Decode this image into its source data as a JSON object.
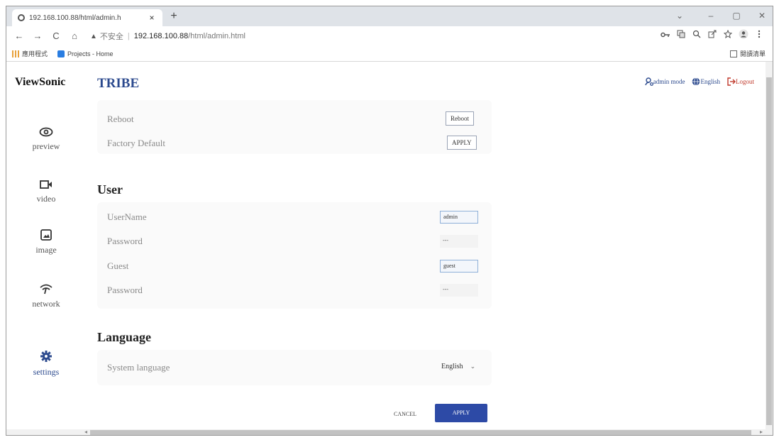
{
  "browser": {
    "tab_title": "192.168.100.88/html/admin.h",
    "tab_close": "×",
    "new_tab": "+",
    "window": {
      "collapse": "⌄",
      "minimize": "–",
      "restore": "▢",
      "close": "✕"
    },
    "nav": {
      "back": "←",
      "forward": "→",
      "reload": "C",
      "home": "⌂"
    },
    "address": {
      "warning_icon": "▲",
      "insecure_label": "不安全",
      "separator": "|",
      "host": "192.168.100.88",
      "path": "/html/admin.html"
    },
    "toolbar_icons": [
      "key-icon",
      "translate-icon",
      "zoom-icon",
      "share-icon",
      "star-icon",
      "profile-icon",
      "menu-icon"
    ],
    "bookmarks": {
      "apps": "應用程式",
      "projects": "Projects - Home",
      "reading_list": "閱讀清單"
    }
  },
  "app": {
    "brand": "ViewSonic",
    "title": "TRIBE",
    "header": {
      "admin_mode": "admin mode",
      "language": "English",
      "logout": "Logout"
    },
    "sidebar": [
      {
        "label": "preview",
        "icon": "eye-icon"
      },
      {
        "label": "video",
        "icon": "camera-icon"
      },
      {
        "label": "image",
        "icon": "image-icon"
      },
      {
        "label": "network",
        "icon": "wifi-icon"
      },
      {
        "label": "settings",
        "icon": "gear-icon",
        "active": true
      }
    ],
    "system": {
      "reboot_label": "Reboot",
      "reboot_button": "Reboot",
      "factory_label": "Factory Default",
      "factory_button": "APPLY"
    },
    "user": {
      "heading": "User",
      "username_label": "UserName",
      "username_value": "admin",
      "password1_label": "Password",
      "password1_value": "---",
      "guest_label": "Guest",
      "guest_value": "guest",
      "password2_label": "Password",
      "password2_value": "---"
    },
    "language": {
      "heading": "Language",
      "system_language_label": "System language",
      "system_language_value": "English"
    },
    "footer": {
      "cancel": "CANCEL",
      "apply": "APPLY"
    }
  },
  "colors": {
    "brand_blue": "#2c4a8e",
    "apply_bg": "#2d4aa6",
    "logout_red": "#c0392b"
  }
}
